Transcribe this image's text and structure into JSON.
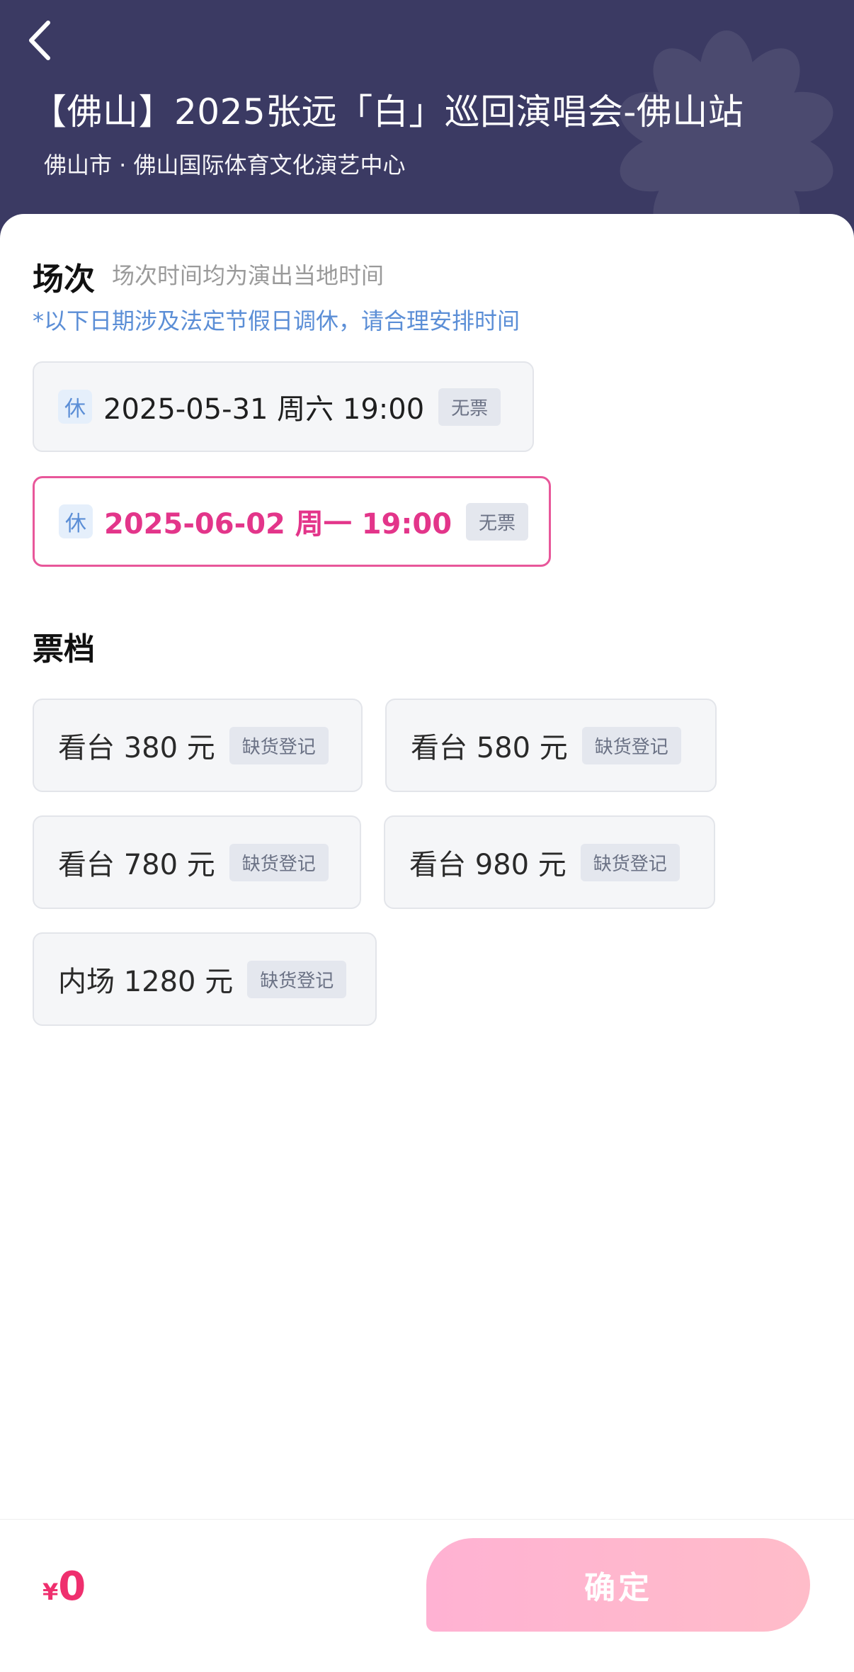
{
  "header": {
    "title": "【佛山】2025张远「白」巡回演唱会-佛山站",
    "venue": "佛山市 · 佛山国际体育文化演艺中心",
    "back_icon": "chevron-left-icon"
  },
  "sessions": {
    "title": "场次",
    "hint": "场次时间均为演出当地时间",
    "notice": "*以下日期涉及法定节假日调休，请合理安排时间",
    "items": [
      {
        "rest": "休",
        "label": "2025-05-31 周六 19:00",
        "status": "无票",
        "selected": false
      },
      {
        "rest": "休",
        "label": "2025-06-02 周一 19:00",
        "status": "无票",
        "selected": true
      }
    ]
  },
  "tiers": {
    "title": "票档",
    "items": [
      {
        "label": "看台 380 元",
        "tag": "缺货登记"
      },
      {
        "label": "看台 580 元",
        "tag": "缺货登记"
      },
      {
        "label": "看台 780 元",
        "tag": "缺货登记"
      },
      {
        "label": "看台 980 元",
        "tag": "缺货登记"
      },
      {
        "label": "内场 1280 元",
        "tag": "缺货登记"
      }
    ]
  },
  "footer": {
    "currency": "¥",
    "total": "0",
    "confirm_label": "确定"
  },
  "colors": {
    "header_bg": "#3b3a63",
    "accent_pink": "#e3358a",
    "price_red": "#ef2f6e",
    "notice_blue": "#5b8ed6",
    "confirm_gradient": [
      "#ffb2d3",
      "#ffbcc9"
    ]
  }
}
